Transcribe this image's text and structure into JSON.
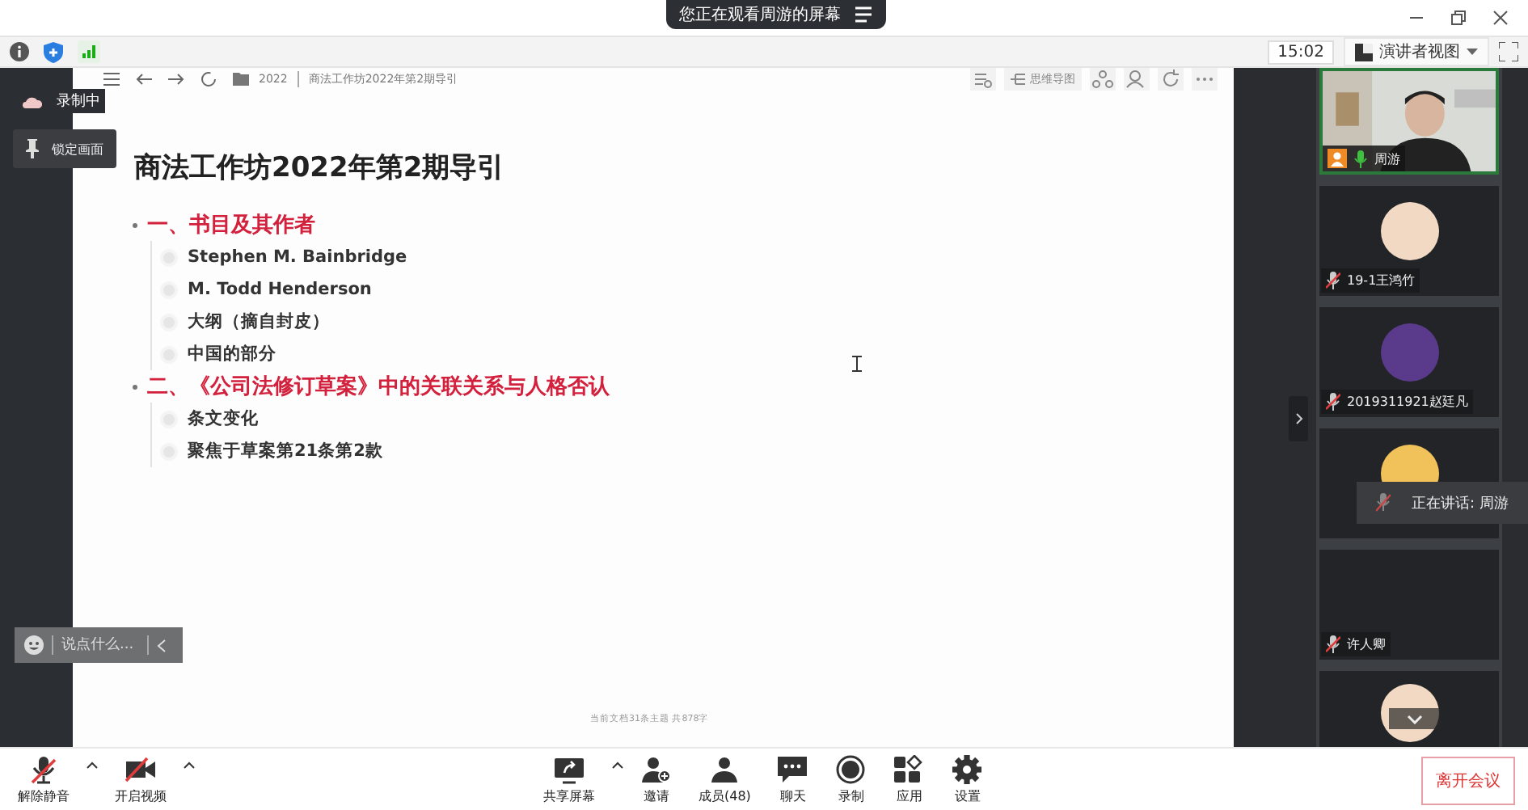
{
  "banner": {
    "text": "您正在观看周游的屏幕"
  },
  "status": {
    "time": "15:02",
    "view": "演讲者视图"
  },
  "overlay": {
    "recording": "录制中",
    "lock": "锁定画面"
  },
  "doc": {
    "folder": "2022",
    "path": "商法工作坊2022年第2期导引",
    "mindmap": "思维导图",
    "title": "商法工作坊2022年第2期导引",
    "sections": [
      {
        "text": "一、书目及其作者",
        "children": [
          "Stephen M. Bainbridge",
          "M. Todd Henderson",
          "大纲（摘自封皮）",
          "中国的部分"
        ]
      },
      {
        "text": "二、《公司法修订草案》中的关联关系与人格否认",
        "children": [
          "条文变化",
          "聚焦于草案第21条第2款"
        ]
      }
    ],
    "footer": "当前文档31条主题 共878字"
  },
  "chat": {
    "placeholder": "说点什么..."
  },
  "participants": [
    {
      "kind": "video",
      "name": "周游",
      "muted": false
    },
    {
      "kind": "avatar",
      "name": "19-1王鸿竹",
      "muted": true
    },
    {
      "kind": "avatar",
      "name": "2019311921赵廷凡",
      "muted": true
    },
    {
      "kind": "avatar"
    },
    {
      "kind": "blank",
      "name": "许人卿",
      "muted": true
    },
    {
      "kind": "avatar"
    }
  ],
  "speaking": "正在讲话: 周游",
  "toolbar_left": [
    {
      "kind": "mic",
      "label": "解除静音"
    },
    {
      "kind": "camera",
      "label": "开启视频"
    }
  ],
  "toolbar_center": [
    {
      "kind": "share",
      "label": "共享屏幕"
    },
    {
      "kind": "invite",
      "label": "邀请"
    },
    {
      "kind": "members",
      "label": "成员(48)"
    },
    {
      "kind": "chat",
      "label": "聊天"
    },
    {
      "kind": "record",
      "label": "录制"
    },
    {
      "kind": "apps",
      "label": "应用"
    },
    {
      "kind": "settings",
      "label": "设置"
    }
  ],
  "leave": "离开会议"
}
